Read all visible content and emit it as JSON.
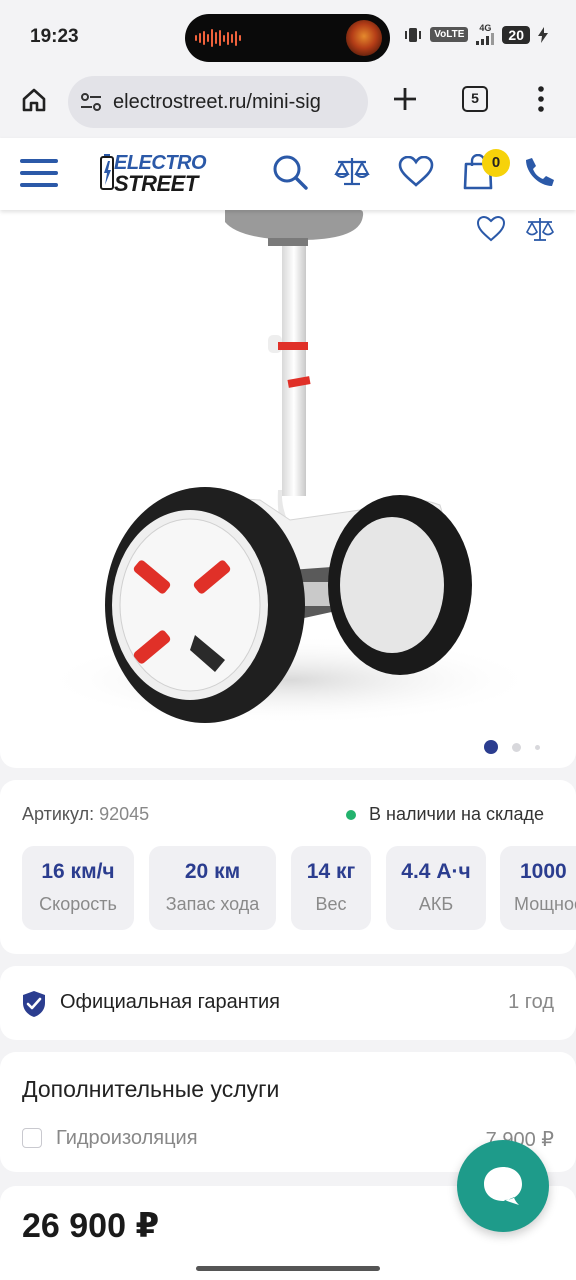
{
  "status_bar": {
    "time": "19:23",
    "volte": "VoLTE",
    "network": "4G",
    "battery": "20"
  },
  "browser": {
    "url": "electrostreet.ru/mini-sig",
    "tabs_count": "5"
  },
  "header": {
    "logo_top": "ELECTRO",
    "logo_bottom": "STREET",
    "cart_count": "0"
  },
  "gallery": {
    "total_slides": 3,
    "active_slide": 1
  },
  "product": {
    "sku_label": "Артикул:",
    "sku_value": "92045",
    "stock": "В наличии на складе",
    "specs": [
      {
        "value": "16 км/ч",
        "label": "Скорость"
      },
      {
        "value": "20 км",
        "label": "Запас хода"
      },
      {
        "value": "14 кг",
        "label": "Вес"
      },
      {
        "value": "4.4 А·ч",
        "label": "АКБ"
      },
      {
        "value": "1000",
        "label": "Мощность"
      }
    ],
    "warranty_label": "Официальная гарантия",
    "warranty_value": "1 год",
    "services_title": "Дополнительные услуги",
    "service_option": {
      "label": "Гидроизоляция",
      "price": "7 900 ₽",
      "checked": false
    },
    "price": "26 900 ₽"
  },
  "colors": {
    "brand_blue": "#2b59a8",
    "spec_blue": "#2b3d8f",
    "accent_yellow": "#f6d20a",
    "fab_teal": "#1e9b8a",
    "stock_green": "#23b26d"
  }
}
